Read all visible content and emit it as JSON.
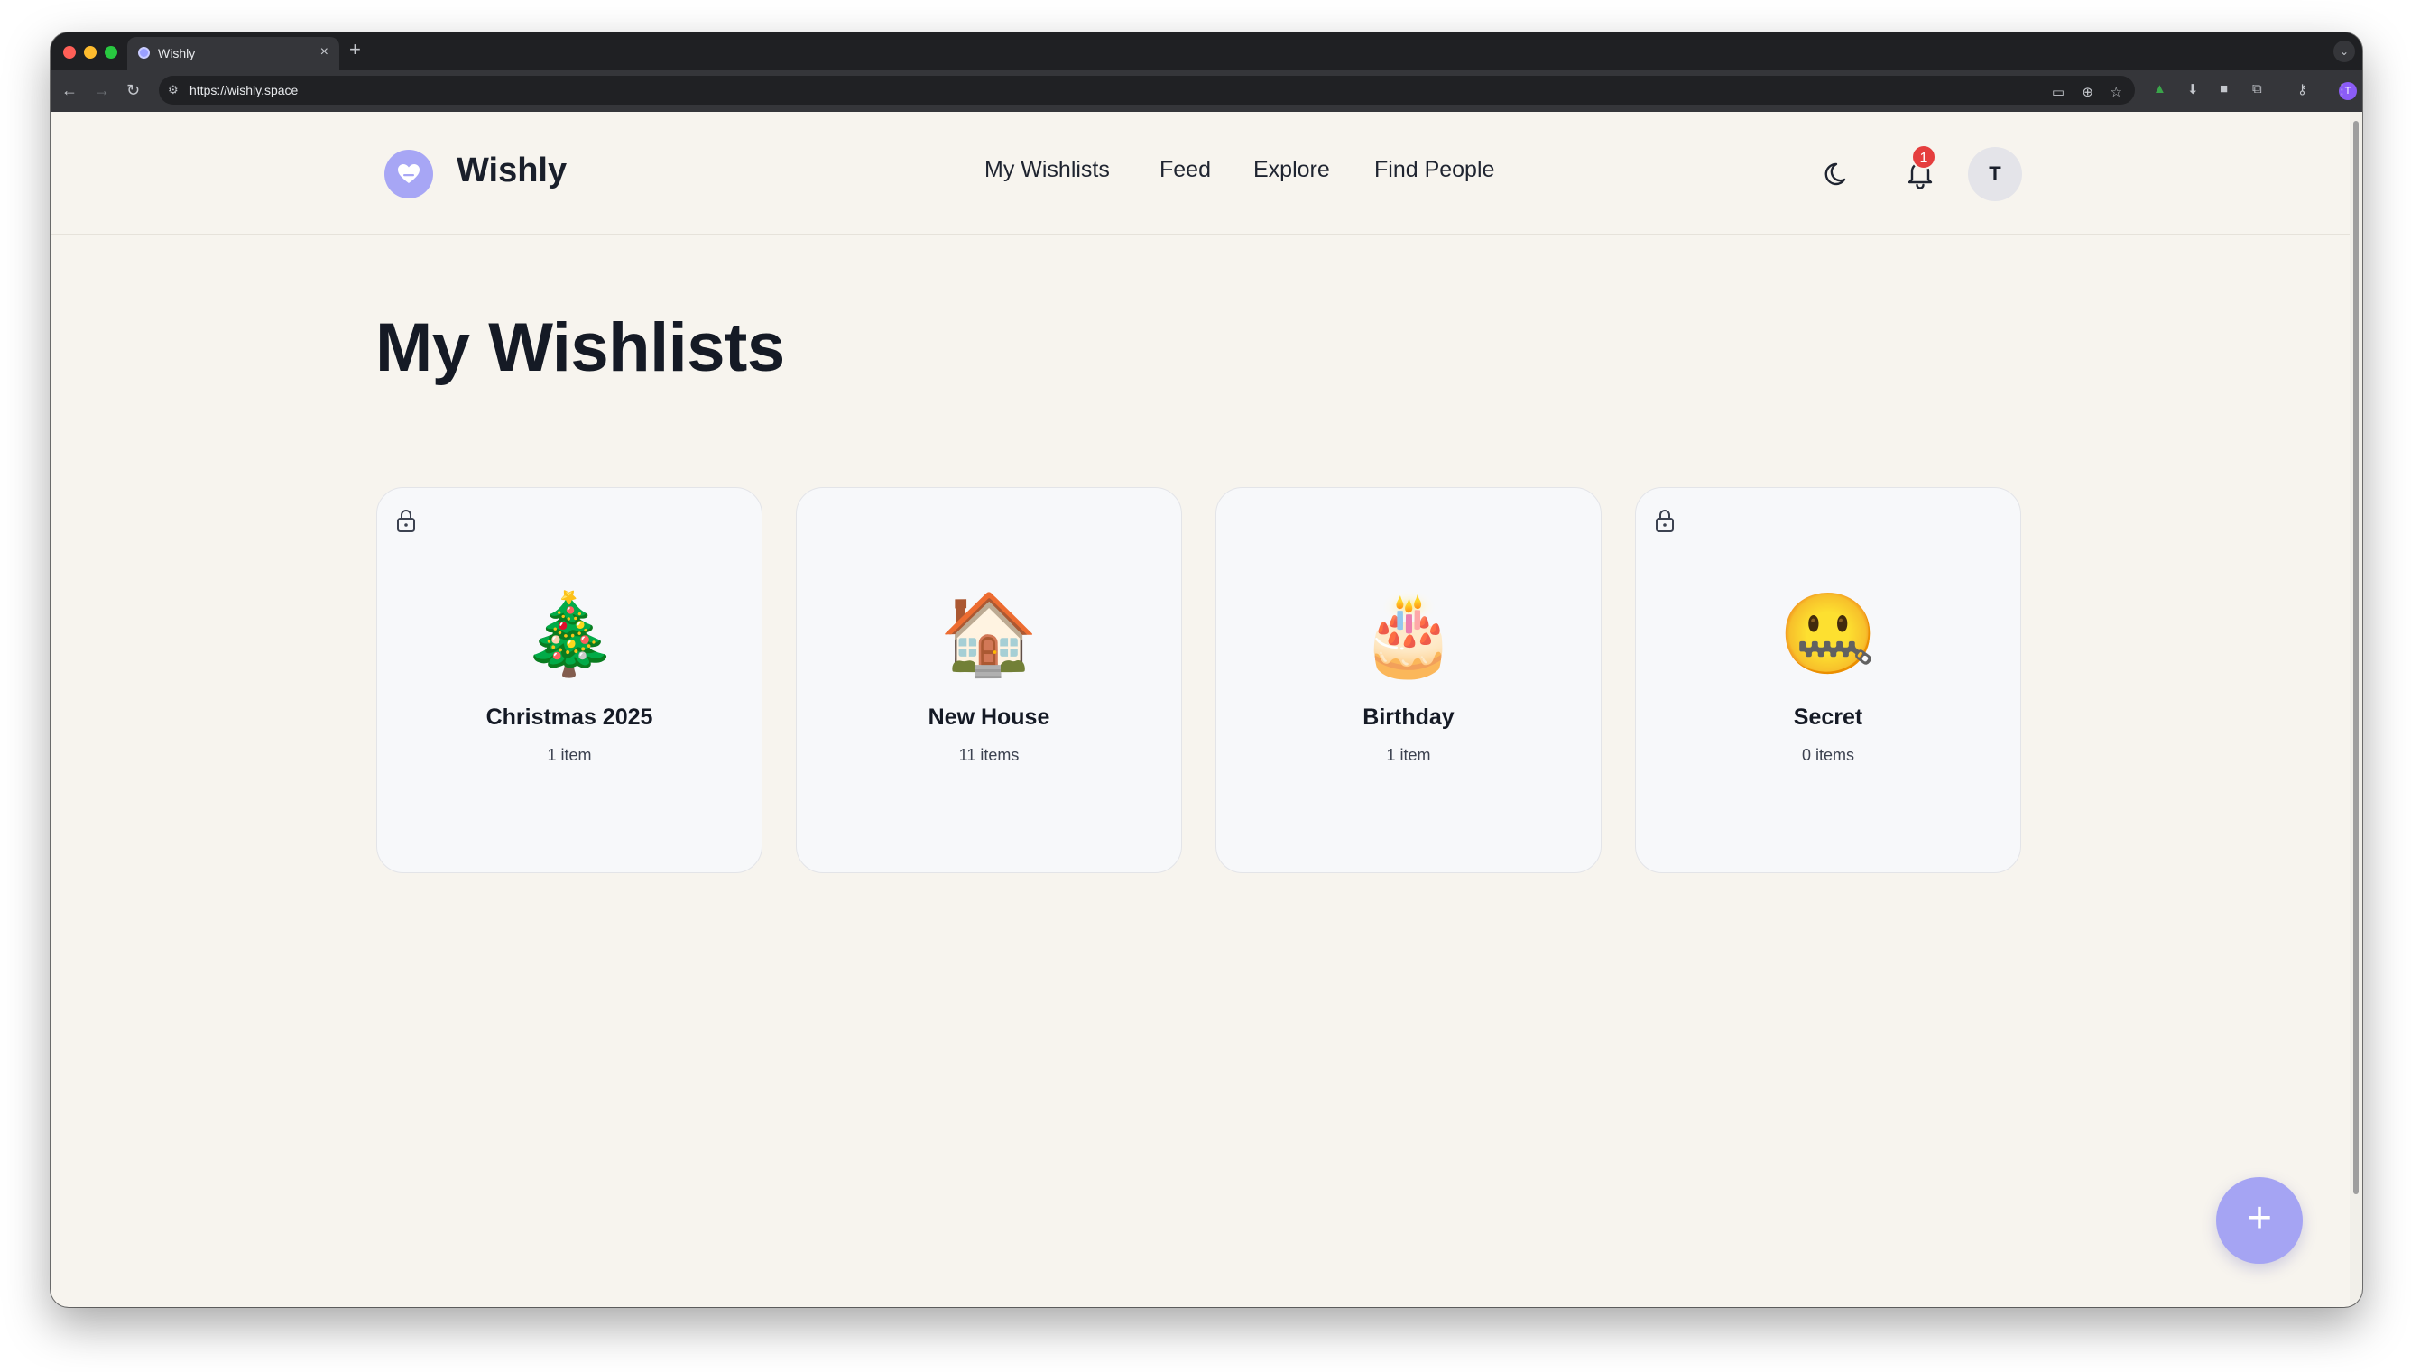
{
  "browser": {
    "tab_title": "Wishly",
    "tab_close": "×",
    "new_tab": "+",
    "url": "https://wishly.space"
  },
  "app": {
    "logo_text": "Wishly",
    "nav": [
      "My Wishlists",
      "Feed",
      "Explore",
      "Find People"
    ],
    "notification_count": "1",
    "avatar_initial": "T",
    "brand_color": "#a7a6f5"
  },
  "main": {
    "title": "My Wishlists",
    "wishlists": [
      {
        "emoji": "🎄",
        "name": "Christmas 2025",
        "count": "1 item",
        "private": true
      },
      {
        "emoji": "🏠",
        "name": "New House",
        "count": "11 items",
        "private": false
      },
      {
        "emoji": "🎂",
        "name": "Birthday",
        "count": "1 item",
        "private": false
      },
      {
        "emoji": "🤐",
        "name": "Secret",
        "count": "0 items",
        "private": true
      }
    ],
    "fab_label": "+"
  }
}
